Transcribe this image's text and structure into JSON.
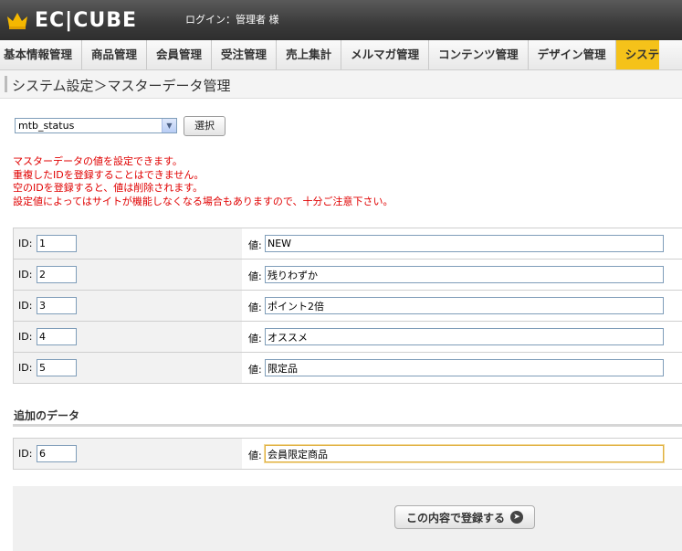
{
  "header": {
    "logo_text": "EC|CUBE",
    "login_status": "ログイン：管理者 様"
  },
  "nav": {
    "items": [
      {
        "label": "基本情報管理"
      },
      {
        "label": "商品管理"
      },
      {
        "label": "会員管理"
      },
      {
        "label": "受注管理"
      },
      {
        "label": "売上集計"
      },
      {
        "label": "メルマガ管理"
      },
      {
        "label": "コンテンツ管理"
      },
      {
        "label": "デザイン管理"
      },
      {
        "label": "システ"
      }
    ],
    "active_index": 8
  },
  "page": {
    "title": "システム設定＞マスターデータ管理"
  },
  "selector": {
    "selected_value": "mtb_status",
    "button_label": "選択"
  },
  "notice": {
    "lines": [
      "マスターデータの値を設定できます。",
      "重複したIDを登録することはできません。",
      "空のIDを登録すると、値は削除されます。",
      "設定値によってはサイトが機能しなくなる場合もありますので、十分ご注意下さい。"
    ]
  },
  "labels": {
    "id": "ID:",
    "value": "値:"
  },
  "rows": [
    {
      "id": "1",
      "value": "NEW"
    },
    {
      "id": "2",
      "value": "残りわずか"
    },
    {
      "id": "3",
      "value": "ポイント2倍"
    },
    {
      "id": "4",
      "value": "オススメ"
    },
    {
      "id": "5",
      "value": "限定品"
    }
  ],
  "add_section": {
    "heading": "追加のデータ",
    "id": "6",
    "value": "会員限定商品"
  },
  "footer": {
    "submit_label": "この内容で登録する"
  },
  "colors": {
    "active_tab": "#f5c21a",
    "notice_text": "#e00000"
  }
}
